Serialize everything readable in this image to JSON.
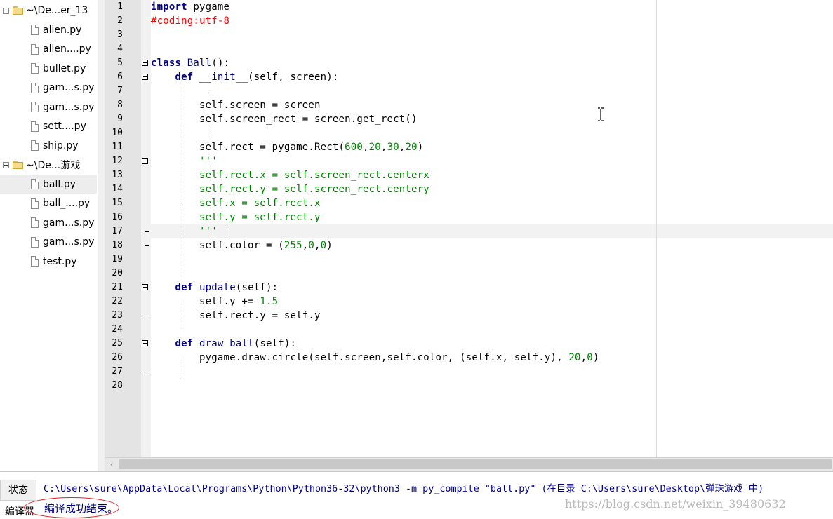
{
  "sidebar": {
    "folders": [
      {
        "label": "~\\De...er_13",
        "files": [
          "alien.py",
          "alien....py",
          "bullet.py",
          "gam...s.py",
          "gam...s.py",
          "sett....py",
          "ship.py"
        ]
      },
      {
        "label": "~\\De...游戏",
        "files": [
          "ball.py",
          "ball_....py",
          "gam...s.py",
          "gam...s.py",
          "test.py"
        ]
      }
    ],
    "selected_file": "ball.py"
  },
  "editor": {
    "line_numbers": [
      "1",
      "2",
      "3",
      "4",
      "5",
      "6",
      "7",
      "8",
      "9",
      "10",
      "11",
      "12",
      "13",
      "14",
      "15",
      "16",
      "17",
      "18",
      "19",
      "20",
      "21",
      "22",
      "23",
      "24",
      "25",
      "26",
      "27",
      "28"
    ],
    "lines": [
      [
        {
          "t": "import",
          "c": "kw"
        },
        {
          "t": " pygame",
          "c": ""
        }
      ],
      [
        {
          "t": "#coding:utf-8",
          "c": "cm"
        }
      ],
      [],
      [],
      [
        {
          "t": "class",
          "c": "kw"
        },
        {
          "t": " ",
          "c": ""
        },
        {
          "t": "Ball",
          "c": "cls"
        },
        {
          "t": "():",
          "c": ""
        }
      ],
      [
        {
          "t": "    ",
          "c": ""
        },
        {
          "t": "def",
          "c": "kw"
        },
        {
          "t": " ",
          "c": ""
        },
        {
          "t": "__init__",
          "c": "cls"
        },
        {
          "t": "(self, screen):",
          "c": ""
        }
      ],
      [],
      [
        {
          "t": "        self.screen = screen",
          "c": ""
        }
      ],
      [
        {
          "t": "        self.screen_rect = screen.get_rect()",
          "c": ""
        }
      ],
      [],
      [
        {
          "t": "        self.rect = pygame.Rect(",
          "c": ""
        },
        {
          "t": "600",
          "c": "num"
        },
        {
          "t": ",",
          "c": ""
        },
        {
          "t": "20",
          "c": "num"
        },
        {
          "t": ",",
          "c": ""
        },
        {
          "t": "30",
          "c": "num"
        },
        {
          "t": ",",
          "c": ""
        },
        {
          "t": "20",
          "c": "num"
        },
        {
          "t": ")",
          "c": ""
        }
      ],
      [
        {
          "t": "        ",
          "c": ""
        },
        {
          "t": "'''",
          "c": "str"
        }
      ],
      [
        {
          "t": "        ",
          "c": ""
        },
        {
          "t": "self.rect.x = self.screen_rect.centerx",
          "c": "str"
        }
      ],
      [
        {
          "t": "        ",
          "c": ""
        },
        {
          "t": "self.rect.y = self.screen_rect.centery",
          "c": "str"
        }
      ],
      [
        {
          "t": "        ",
          "c": ""
        },
        {
          "t": "self.x = self.rect.x",
          "c": "str"
        }
      ],
      [
        {
          "t": "        ",
          "c": ""
        },
        {
          "t": "self.y = self.rect.y",
          "c": "str"
        }
      ],
      [
        {
          "t": "        ",
          "c": ""
        },
        {
          "t": "'''",
          "c": "str"
        }
      ],
      [
        {
          "t": "        self.color = (",
          "c": ""
        },
        {
          "t": "255",
          "c": "num"
        },
        {
          "t": ",",
          "c": ""
        },
        {
          "t": "0",
          "c": "num"
        },
        {
          "t": ",",
          "c": ""
        },
        {
          "t": "0",
          "c": "num"
        },
        {
          "t": ")",
          "c": ""
        }
      ],
      [],
      [],
      [
        {
          "t": "    ",
          "c": ""
        },
        {
          "t": "def",
          "c": "kw"
        },
        {
          "t": " ",
          "c": ""
        },
        {
          "t": "update",
          "c": "cls"
        },
        {
          "t": "(self):",
          "c": ""
        }
      ],
      [
        {
          "t": "        self.y += ",
          "c": ""
        },
        {
          "t": "1.5",
          "c": "num"
        }
      ],
      [
        {
          "t": "        self.rect.y = self.y",
          "c": ""
        }
      ],
      [],
      [
        {
          "t": "    ",
          "c": ""
        },
        {
          "t": "def",
          "c": "kw"
        },
        {
          "t": " ",
          "c": ""
        },
        {
          "t": "draw_ball",
          "c": "cls"
        },
        {
          "t": "(self):",
          "c": ""
        }
      ],
      [
        {
          "t": "        pygame.draw.circle(self.screen,self.color, (self.x, self.y), ",
          "c": ""
        },
        {
          "t": "20",
          "c": "num"
        },
        {
          "t": ",",
          "c": ""
        },
        {
          "t": "0",
          "c": "num"
        },
        {
          "t": ")",
          "c": ""
        }
      ],
      [],
      []
    ]
  },
  "output": {
    "tab_status": "状态",
    "tab_compiler": "编译器",
    "command_line": "C:\\Users\\sure\\AppData\\Local\\Programs\\Python\\Python36-32\\python3 -m py_compile \"ball.py\" (在目录 C:\\Users\\sure\\Desktop\\弹珠游戏 中)",
    "result": "编译成功结束。"
  },
  "watermark": "https://blog.csdn.net/weixin_39480632",
  "colors": {
    "keyword": "#00008b",
    "comment": "#ff0000",
    "string": "#008000",
    "number": "#008000",
    "output_text": "#00008b",
    "annotation_circle": "#e02020"
  }
}
